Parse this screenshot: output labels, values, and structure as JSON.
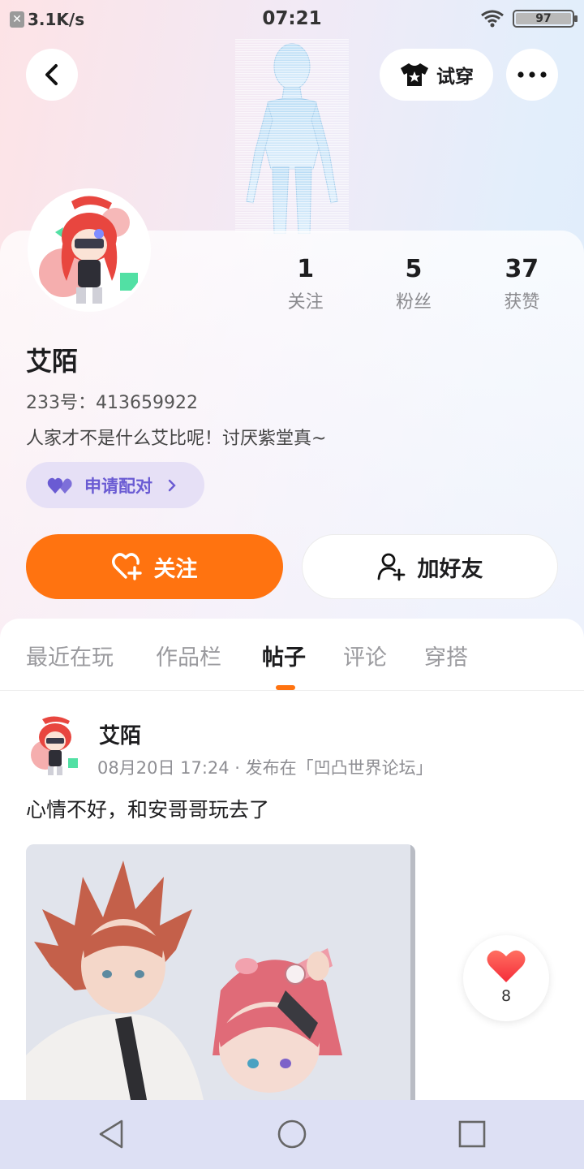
{
  "status_bar": {
    "net_speed": "3.1K/s",
    "time": "07:21",
    "battery": "97"
  },
  "header": {
    "try_on_label": "试穿"
  },
  "profile": {
    "name": "艾陌",
    "uid": "233号：413659922",
    "bio": "人家才不是什么艾比呢！讨厌紫堂真~",
    "pair_button": "申请配对",
    "stats": [
      {
        "value": "1",
        "label": "关注"
      },
      {
        "value": "5",
        "label": "粉丝"
      },
      {
        "value": "37",
        "label": "获赞"
      }
    ]
  },
  "actions": {
    "follow_label": "关注",
    "add_friend_label": "加好友"
  },
  "tabs": [
    {
      "label": "最近在玩"
    },
    {
      "label": "作品栏"
    },
    {
      "label": "帖子",
      "active": true
    },
    {
      "label": "评论"
    },
    {
      "label": "穿搭"
    }
  ],
  "post": {
    "author": "艾陌",
    "meta": "08月20日 17:24 · 发布在「凹凸世界论坛」",
    "text": "心情不好，和安哥哥玩去了",
    "like_count": "8"
  },
  "colors": {
    "accent": "#ff7310",
    "pair_text": "#6a5bd3",
    "pair_bg": "#e6e0f6",
    "navbar_bg": "#dde0f4"
  }
}
